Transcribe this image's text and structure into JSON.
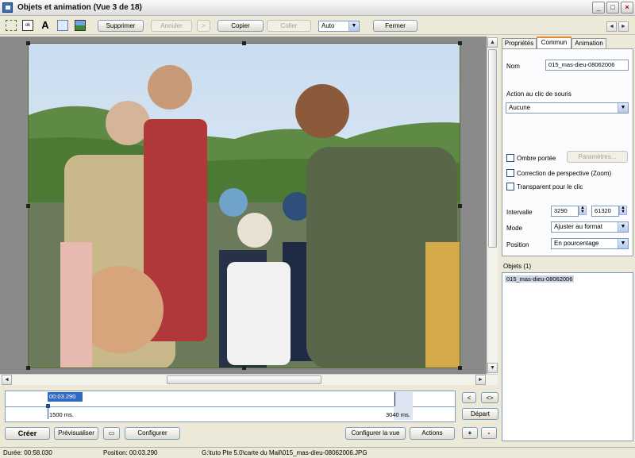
{
  "window": {
    "title": "Objets et animation  (Vue 3 de 18)",
    "controls": [
      "_",
      "□",
      "×"
    ]
  },
  "toolbar": {
    "supprimer": "Supprimer",
    "annuler": "Annuler",
    "redo": ">",
    "copier": "Copier",
    "coller": "Coller",
    "zoom_value": "Auto",
    "fermer": "Fermer",
    "nav_prev": "◄",
    "nav_next": "►"
  },
  "tabs": [
    "Propriétés",
    "Commun",
    "Animation"
  ],
  "properties": {
    "nom_label": "Nom",
    "nom_value": "015_mas-dieu-08062006",
    "action_label": "Action au clic de souris",
    "action_value": "Aucune",
    "ombre_label": "Ombre portée",
    "parametres": "Paramètres...",
    "perspective_label": "Correction de perspective (Zoom)",
    "transparent_label": "Transparent pour le clic",
    "intervalle_label": "Intervalle",
    "intervalle_start": "3290",
    "intervalle_end": "61320",
    "mode_label": "Mode",
    "mode_value": "Ajuster au format",
    "position_label": "Position",
    "position_value": "En pourcentage"
  },
  "objects": {
    "header": "Objets (1)",
    "items": [
      "015_mas-dieu-08062006"
    ]
  },
  "timeline": {
    "current_time": "00:03.290",
    "start_marker": "1500 ms.",
    "end_marker": "3040 ms.",
    "btn_left": "<",
    "btn_right": "<>",
    "depart": "Départ",
    "plus": "+",
    "minus": "-"
  },
  "bottom": {
    "creer": "Créer",
    "previsualiser": "Prévisualiser",
    "configurer": "Configurer",
    "configurer_vue": "Configurer la vue",
    "actions": "Actions"
  },
  "status": {
    "duree": "Durée:  00:58.030",
    "position": "Position:  00:03.290",
    "path": "G:\\tuto Pte 5.0\\carte du Mail\\015_mas-dieu-08062006.JPG"
  },
  "colors": {
    "selection": "#cdd4e2",
    "accent_tab": "#e68b2c",
    "photo_frame": "#556b2f"
  }
}
